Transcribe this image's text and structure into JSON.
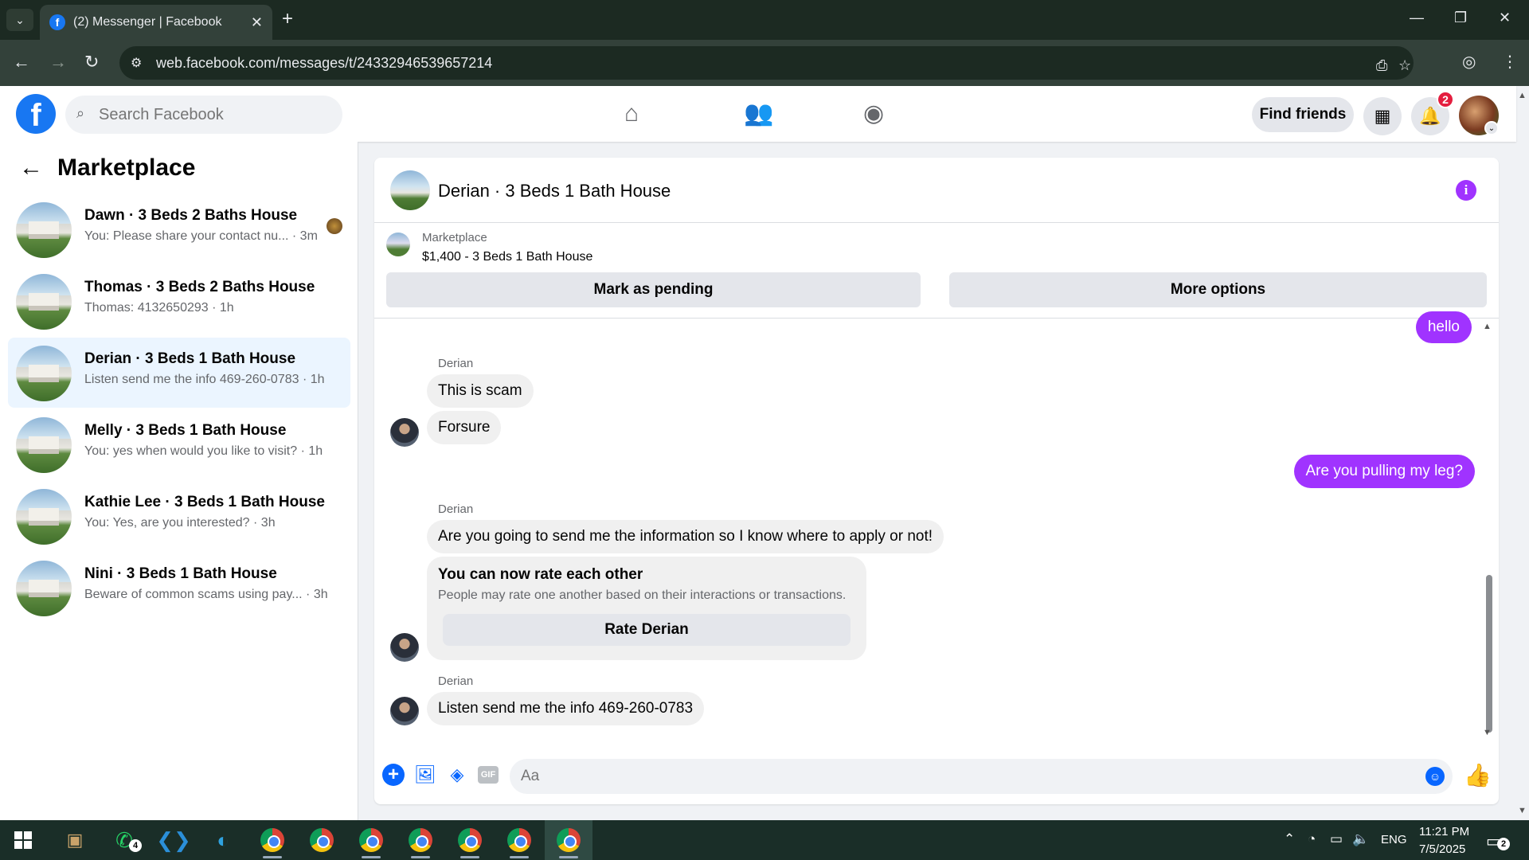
{
  "browser": {
    "tab_title": "(2) Messenger | Facebook",
    "url": "web.facebook.com/messages/t/24332946539657214"
  },
  "fb_header": {
    "search_placeholder": "Search Facebook",
    "find_friends_label": "Find friends",
    "notification_count": "2"
  },
  "sidebar": {
    "title": "Marketplace",
    "conversations": [
      {
        "name": "Dawn · 3 Beds 2 Baths House",
        "preview": "You: Please share your contact nu... · 3m"
      },
      {
        "name": "Thomas · 3 Beds 2 Baths House",
        "preview": "Thomas: 4132650293 · 1h"
      },
      {
        "name": "Derian · 3 Beds 1 Bath House",
        "preview": "Listen send me the info  469-260-0783 · 1h"
      },
      {
        "name": "Melly · 3 Beds 1 Bath House",
        "preview": "You: yes when would you like to visit? · 1h"
      },
      {
        "name": "Kathie Lee · 3 Beds 1 Bath House",
        "preview": "You: Yes, are you interested? · 3h"
      },
      {
        "name": "Nini · 3 Beds 1 Bath House",
        "preview": "Beware of common scams using pay...  · 3h"
      }
    ]
  },
  "chat": {
    "title": "Derian · 3 Beds 1 Bath House",
    "listing": {
      "label": "Marketplace",
      "price_title": "$1,400 - 3 Beds 1 Bath House",
      "mark_pending_label": "Mark as pending",
      "more_options_label": "More options"
    },
    "messages": {
      "out_hello": "hello",
      "sender_1": "Derian",
      "in_1": "This is scam",
      "in_2": "Forsure",
      "out_leg": "Are you pulling my leg?",
      "sender_2": "Derian",
      "in_3": "Are you going to send me the information so I know where to apply or not!",
      "rate_title": "You can now rate each other",
      "rate_sub": "People may rate one another based on their interactions or transactions.",
      "rate_button": "Rate Derian",
      "sender_3": "Derian",
      "in_4": "Listen send me the info 469-260-0783"
    },
    "composer": {
      "placeholder": "Aa",
      "gif_label": "GIF"
    }
  },
  "taskbar": {
    "whatsapp_badge": "4",
    "language": "ENG",
    "time": "11:21 PM",
    "date": "7/5/2025",
    "notifications_badge": "2"
  },
  "colors": {
    "fb_blue": "#1877f2",
    "messenger_purple": "#a033ff",
    "active_conversation": "#ebf5ff"
  }
}
